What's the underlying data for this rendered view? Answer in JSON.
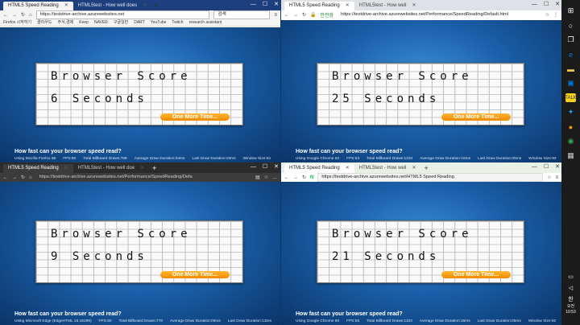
{
  "browsers": [
    {
      "tabs": [
        {
          "label": "HTML5 Speed Reading"
        },
        {
          "label": "HTML5test - How well does"
        }
      ],
      "url": "https://testdrive-archive.azurewebsites.net",
      "search_placeholder": "검색",
      "bookmarks": [
        "Firefox 시작하기",
        "클라우드",
        "주식,경제",
        "Keep",
        "NAVER",
        "구글일반",
        "DART",
        "YouTube",
        "Twitch",
        "research assistant"
      ],
      "board": {
        "line1": "Browser Score",
        "line2": "6 Seconds"
      },
      "question": "How fast can your browser speed read?",
      "stats": [
        "Using Mozilla Firefox 58",
        "FPS:60",
        "Total Billboard Draws:788",
        "Average Draw Duration:04ms",
        "Last Draw Duration:03ms",
        "Window Size:63"
      ]
    },
    {
      "tabs": [
        {
          "label": "HTML5 Speed Reading"
        },
        {
          "label": "HTML5test - How well"
        }
      ],
      "security": "안전함",
      "url": "https://testdrive-archive.azurewebsites.net/Performance/SpeedReading/Default.html",
      "board": {
        "line1": "Browser Score",
        "line2": "25 Seconds"
      },
      "question": "How fast can your browser speed read?",
      "stats": [
        "Using Google Chrome 62",
        "FPS:53",
        "Total Billboard Draws:1233",
        "Average Draw Duration:18ms",
        "Last Draw Duration:05ms",
        "Window Size:92"
      ]
    },
    {
      "tabs": [
        {
          "label": "HTML5 Speed Reading"
        },
        {
          "label": "HTML5test - How well doe"
        }
      ],
      "url": "https://testdrive-archive.azurewebsites.net/Performance/SpeedReading/Defa",
      "board": {
        "line1": "Browser Score",
        "line2": "9 Seconds"
      },
      "question": "How fast can your browser speed read?",
      "stats": [
        "Using Microsoft Edge (EdgeHTML 16.16299)",
        "FPS:60",
        "Total Billboard Draws:778",
        "Average Draw Duration:06ms",
        "Last Draw Duration:13ms"
      ]
    },
    {
      "tabs": [
        {
          "label": "HTML5 Speed Reading"
        },
        {
          "label": "HTML5test - How well"
        }
      ],
      "url": "https://testdrive-archive.azurewebsites.net/HTML5 Speed Reading",
      "board": {
        "line1": "Browser Score",
        "line2": "21 Seconds"
      },
      "question": "How fast can your browser speed read?",
      "stats": [
        "Using Google Chrome 60",
        "FPS:55",
        "Total Billboard Draws:1103",
        "Average Draw Duration:15ms",
        "Last Draw Duration:05ms",
        "Window Size:92"
      ]
    }
  ],
  "button_label": "One More Time...",
  "taskbar": {
    "ime": "한",
    "time": "오전\n10:53"
  }
}
